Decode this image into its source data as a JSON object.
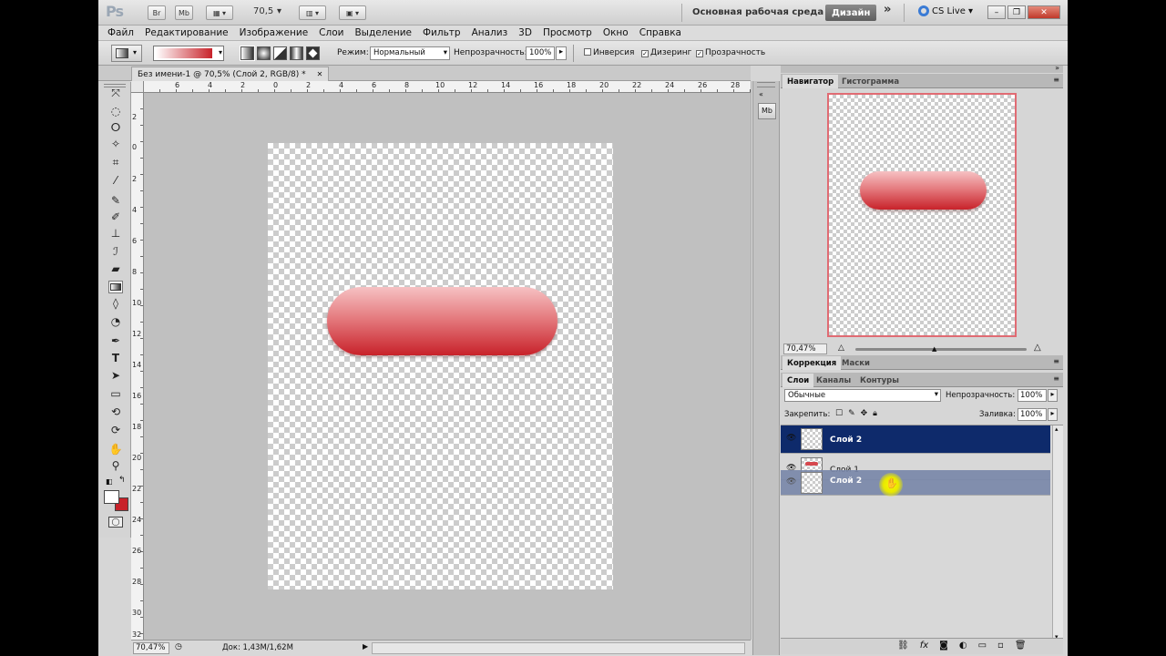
{
  "titlebar": {
    "app_logo": "Ps",
    "bridge_btn": "Br",
    "minibridge_btn": "Mb",
    "zoom_value": "70,5",
    "workspace_label": "Основная рабочая среда",
    "workspace_active": "Дизайн",
    "more": "»",
    "cslive": "CS Live",
    "minimize": "–",
    "restore": "❐",
    "close": "✕"
  },
  "menu": [
    "Файл",
    "Редактирование",
    "Изображение",
    "Слои",
    "Выделение",
    "Фильтр",
    "Анализ",
    "3D",
    "Просмотр",
    "Окно",
    "Справка"
  ],
  "options": {
    "mode_label": "Режим:",
    "mode_value": "Нормальный",
    "opacity_label": "Непрозрачность:",
    "opacity_value": "100%",
    "invert_label": "Инверсия",
    "dither_label": "Дизеринг",
    "transparency_label": "Прозрачность",
    "check_mark": "✓"
  },
  "document": {
    "tab_title": "Без имени-1 @ 70,5% (Слой 2, RGB/8) *",
    "tab_close": "✕"
  },
  "ruler": {
    "top": [
      "6",
      "4",
      "2",
      "0",
      "2",
      "4",
      "6",
      "8",
      "10",
      "12",
      "14",
      "16",
      "18",
      "20",
      "22",
      "24",
      "26",
      "28"
    ],
    "left": [
      "2",
      "0",
      "2",
      "4",
      "6",
      "8",
      "10",
      "12",
      "14",
      "16",
      "18",
      "20",
      "22",
      "24",
      "26",
      "28",
      "30",
      "32"
    ]
  },
  "status": {
    "zoom": "70,47%",
    "doc": "Док: 1,43M/1,62M"
  },
  "collapsed_icon": "Mb",
  "navigator": {
    "tab_active": "Навигатор",
    "tab_other": "Гистограмма",
    "zoom": "70,47%"
  },
  "adjust": {
    "tab_active": "Коррекция",
    "tab_other": "Маски"
  },
  "layers": {
    "tab_active": "Слои",
    "tab_channels": "Каналы",
    "tab_paths": "Контуры",
    "blend_mode": "Обычные",
    "opacity_label": "Непрозрачность:",
    "opacity_value": "100%",
    "lock_label": "Закрепить:",
    "fill_label": "Заливка:",
    "fill_value": "100%",
    "eye": "👁",
    "rows": [
      {
        "name": "Слой 2"
      },
      {
        "name": "Слой 1"
      },
      {
        "name": "Слой 2"
      }
    ]
  },
  "colors": {
    "selected_row": "#0e2a6b",
    "drag_row": "#7a88aa",
    "cursor_halo": "#e8e800",
    "pill_red": "#c8222a"
  }
}
